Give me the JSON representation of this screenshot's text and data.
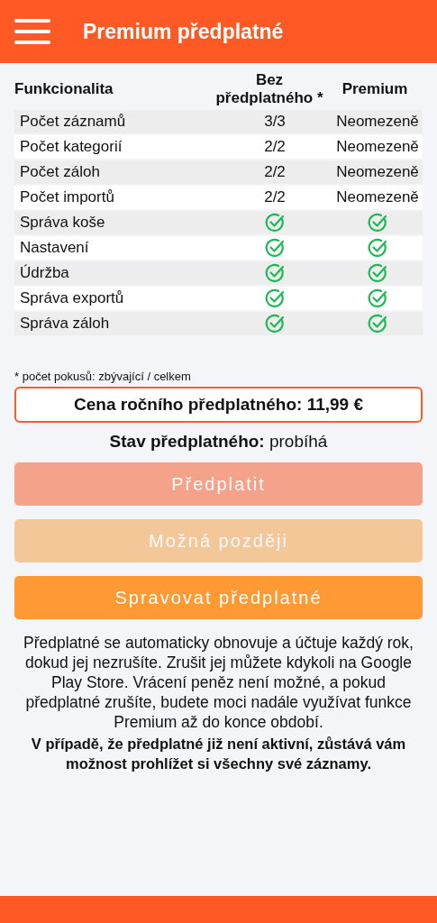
{
  "header": {
    "title": "Premium předplatné"
  },
  "table": {
    "columns": [
      "Funkcionalita",
      "Bez předplatného *",
      "Premium"
    ],
    "rows": [
      {
        "cells": [
          {
            "kind": "text",
            "text": "Počet záznamů"
          },
          {
            "kind": "text",
            "text": "3/3"
          },
          {
            "kind": "text",
            "text": "Neomezeně"
          }
        ]
      },
      {
        "cells": [
          {
            "kind": "text",
            "text": "Počet kategorií"
          },
          {
            "kind": "text",
            "text": "2/2"
          },
          {
            "kind": "text",
            "text": "Neomezeně"
          }
        ]
      },
      {
        "cells": [
          {
            "kind": "text",
            "text": "Počet záloh"
          },
          {
            "kind": "text",
            "text": "2/2"
          },
          {
            "kind": "text",
            "text": "Neomezeně"
          }
        ]
      },
      {
        "cells": [
          {
            "kind": "text",
            "text": "Počet importů"
          },
          {
            "kind": "text",
            "text": "2/2"
          },
          {
            "kind": "text",
            "text": "Neomezeně"
          }
        ]
      },
      {
        "cells": [
          {
            "kind": "text",
            "text": "Správa koše"
          },
          {
            "kind": "check"
          },
          {
            "kind": "check"
          }
        ]
      },
      {
        "cells": [
          {
            "kind": "text",
            "text": "Nastavení"
          },
          {
            "kind": "check"
          },
          {
            "kind": "check"
          }
        ]
      },
      {
        "cells": [
          {
            "kind": "text",
            "text": "Údržba"
          },
          {
            "kind": "check"
          },
          {
            "kind": "check"
          }
        ]
      },
      {
        "cells": [
          {
            "kind": "text",
            "text": "Správa exportů"
          },
          {
            "kind": "check"
          },
          {
            "kind": "check"
          }
        ]
      },
      {
        "cells": [
          {
            "kind": "text",
            "text": "Správa záloh"
          },
          {
            "kind": "check"
          },
          {
            "kind": "check"
          }
        ]
      }
    ]
  },
  "footnote": "* počet pokusů: zbývající / celkem",
  "price": "Cena ročního předplatného: 11,99 €",
  "status": "**Stav předplatného:** probíhá",
  "buttons": [
    {
      "label": "Předplatit",
      "kind": "primary",
      "disabled": true
    },
    {
      "label": "Možná později",
      "kind": "secondary",
      "disabled": true
    },
    {
      "label": "Spravovat předplatné",
      "kind": "accent",
      "disabled": false
    }
  ],
  "info": "Předplatné se automaticky obnovuje a účtuje každý rok, dokud jej nezrušíte. Zrušit jej můžete kdykoli na Google Play Store. Vrácení peněz není možné, a pokud předplatné zrušíte, budete moci nadále využívat funkce Premium až do konce období.",
  "note": "V případě, že předplatné již není aktivní, zůstává vám možnost prohlížet si všechny své záznamy."
}
